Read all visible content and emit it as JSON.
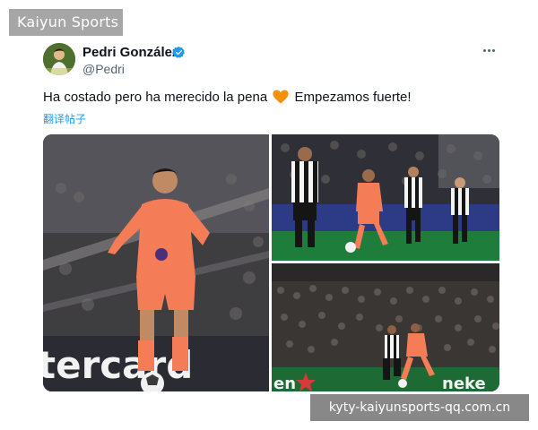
{
  "watermark_top": "Kaiyun Sports",
  "watermark_bottom": "kyty-kaiyunsports-qq.com.cn",
  "tweet": {
    "author_name": "Pedri González",
    "author_handle": "@Pedri",
    "text_before_emoji": "Ha costado pero ha merecido la pena",
    "text_after_emoji": "Empezamos fuerte!",
    "emoji": "orange-heart-icon",
    "translate_label": "翻译帖子"
  },
  "media": {
    "ad_board_1": "tercard",
    "ad_board_2": "en",
    "ad_board_3": "neke"
  },
  "colors": {
    "link_blue": "#1d9bf0",
    "verified_blue": "#1d9bf0",
    "heart_orange": "#f4900c",
    "kit_orange": "#f47c56",
    "text_primary": "#0f1419",
    "text_secondary": "#536471"
  }
}
